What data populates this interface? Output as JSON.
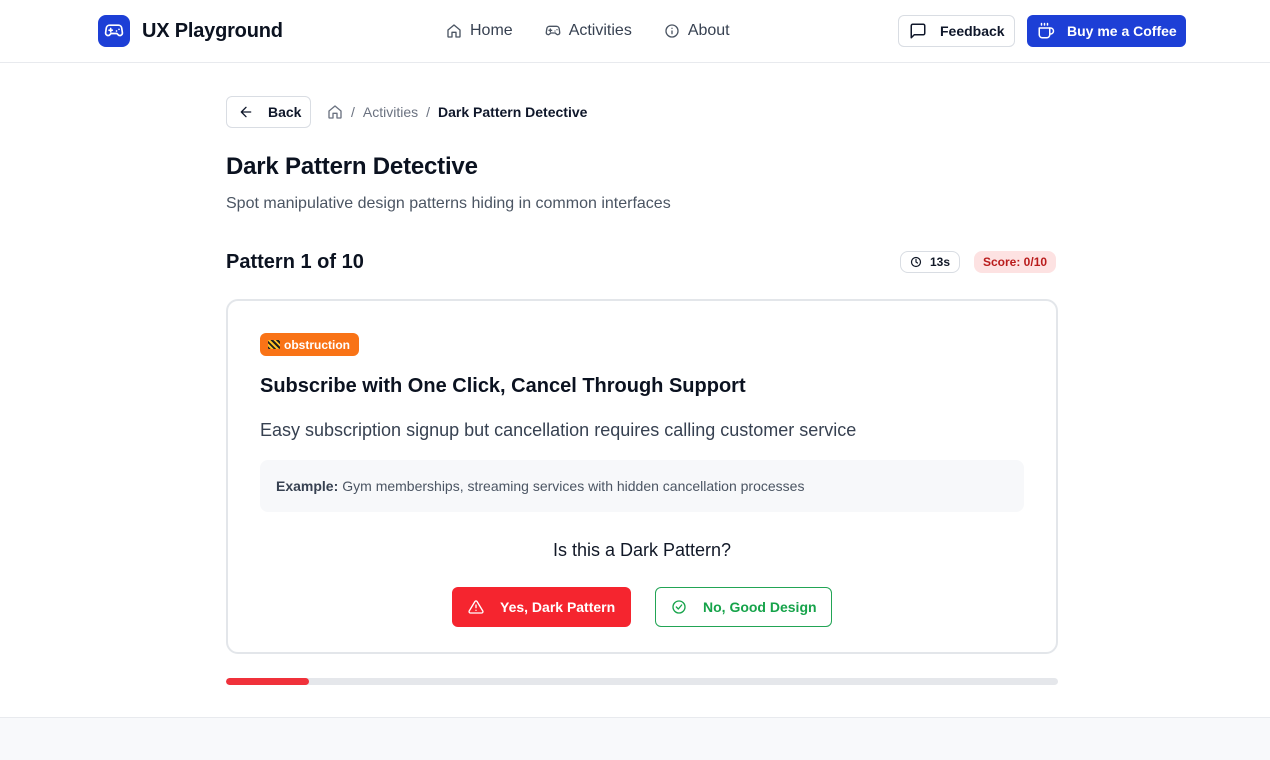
{
  "header": {
    "brand_name": "UX Playground",
    "nav": [
      {
        "label": "Home",
        "icon": "home-icon"
      },
      {
        "label": "Activities",
        "icon": "gamepad-icon"
      },
      {
        "label": "About",
        "icon": "info-icon"
      }
    ],
    "feedback_label": "Feedback",
    "coffee_label": "Buy me a Coffee"
  },
  "breadcrumb": {
    "back_label": "Back",
    "separator": "/",
    "activities": "Activities",
    "current": "Dark Pattern Detective"
  },
  "page": {
    "title": "Dark Pattern Detective",
    "subtitle": "Spot manipulative design patterns hiding in common interfaces",
    "progress_label": "Pattern 1 of 10",
    "timer": "13s",
    "score": "Score: 0/10"
  },
  "card": {
    "tag": "obstruction",
    "title": "Subscribe with One Click, Cancel Through Support",
    "description": "Easy subscription signup but cancellation requires calling customer service",
    "example_label": "Example:",
    "example_text": "Gym memberships, streaming services with hidden cancellation processes",
    "question": "Is this a Dark Pattern?",
    "yes_label": "Yes, Dark Pattern",
    "no_label": "No, Good Design"
  },
  "progress": {
    "current": 1,
    "total": 10,
    "fraction": 0.1
  },
  "colors": {
    "brand": "#1d3fd6",
    "danger": "#f5252f",
    "success": "#16a34a",
    "tag": "#f97316",
    "score_bg": "#fde2e2",
    "score_text": "#b91c1c"
  }
}
